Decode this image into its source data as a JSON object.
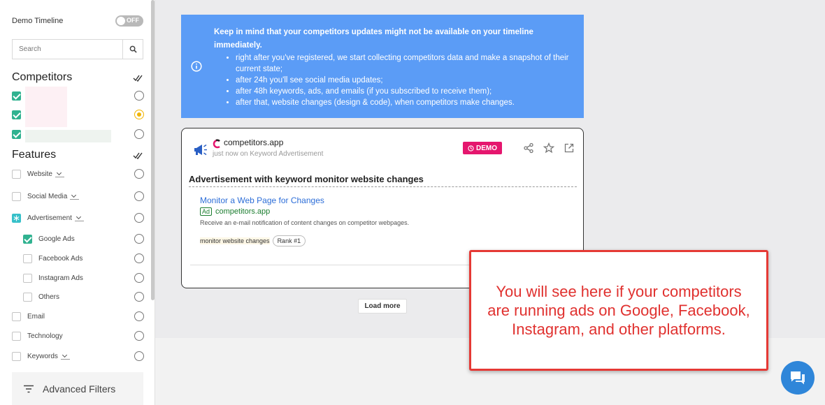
{
  "sidebar": {
    "demo_timeline_label": "Demo Timeline",
    "toggle_label": "OFF",
    "search_placeholder": "Search",
    "competitors_title": "Competitors",
    "features_title": "Features",
    "features": [
      {
        "label": "Website"
      },
      {
        "label": "Social Media"
      },
      {
        "label": "Advertisement"
      },
      {
        "label": "Google Ads"
      },
      {
        "label": "Facebook Ads"
      },
      {
        "label": "Instagram Ads"
      },
      {
        "label": "Others"
      },
      {
        "label": "Email"
      },
      {
        "label": "Technology"
      },
      {
        "label": "Keywords"
      }
    ],
    "advanced_filters_label": "Advanced Filters"
  },
  "info": {
    "title": "Keep in mind that your competitors updates might not be available on your timeline immediately.",
    "items": [
      "right after you've registered, we start collecting competitors data and make a snapshot of their current state;",
      "after 24h you'll see social media updates;",
      "after 48h keywords, ads, and emails (if you subscribed to receive them);",
      "after that, website changes (design & code), when competitors make changes."
    ]
  },
  "card": {
    "source_name": "competitors.app",
    "source_meta": "just now on Keyword Advertisement",
    "badge": "DEMO",
    "title": "Advertisement with keyword monitor website changes",
    "ad_title": "Monitor a Web Page for Changes",
    "ad_tag": "Ad",
    "ad_url": "competitors.app",
    "ad_desc": "Receive an e-mail notification of content changes on competitor webpages.",
    "keyword": "monitor website changes",
    "rank": "Rank #1"
  },
  "load_more_label": "Load more",
  "callout_text": "You will see here if your competitors are running ads on Google, Facebook, Instagram, and other platforms.",
  "colors": {
    "accent_green": "#30b290",
    "info_blue": "#5b9cf6",
    "demo_pink": "#e5166e",
    "callout_red": "#e53935",
    "chat_blue": "#2f86d9"
  }
}
